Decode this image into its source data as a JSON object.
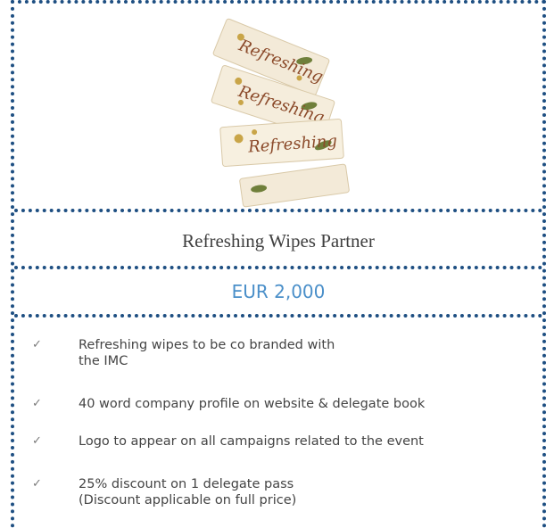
{
  "product": {
    "wipe_label": "Refreshing",
    "title": "Refreshing Wipes Partner",
    "price": "EUR 2,000"
  },
  "features": [
    {
      "line1": "Refreshing wipes to be co branded with",
      "line2": "the IMC"
    },
    {
      "line1": "40 word company profile on website & delegate book"
    },
    {
      "line1": "Logo to appear on all campaigns related to the event"
    },
    {
      "line1": "25% discount on 1 delegate pass",
      "line2": "(Discount applicable on full price)"
    }
  ],
  "icons": {
    "check": "check-icon"
  },
  "colors": {
    "border": "#1e4f82",
    "price": "#4a8fc9",
    "wipe_text": "#8b4a2a"
  }
}
